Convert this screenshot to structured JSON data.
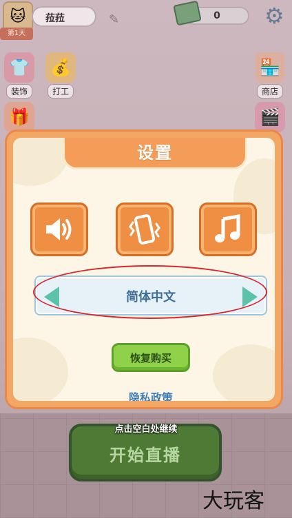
{
  "hud": {
    "day_badge": "第1天",
    "player_name": "菈菈",
    "cash": "0"
  },
  "side_buttons": {
    "decorate": "装饰",
    "work": "打工",
    "shop": "商店"
  },
  "settings": {
    "title": "设置",
    "sound_icon": "speaker-icon",
    "vibration_icon": "phone-vibrate-icon",
    "music_icon": "music-note-icon",
    "language": "简体中文",
    "restore_purchase": "恢复购买",
    "privacy_policy": "隐私政策"
  },
  "bottom": {
    "continue_hint": "点击空白处继续",
    "start_stream": "开始直播",
    "watermark": "大玩客"
  },
  "colors": {
    "dialog_orange": "#f3a764",
    "icon_button_orange": "#ee8f43",
    "language_text": "#3f6e97",
    "arrow_teal": "#5cc3a8",
    "restore_green": "#8fd24a",
    "annotation_red": "#d8252e"
  }
}
